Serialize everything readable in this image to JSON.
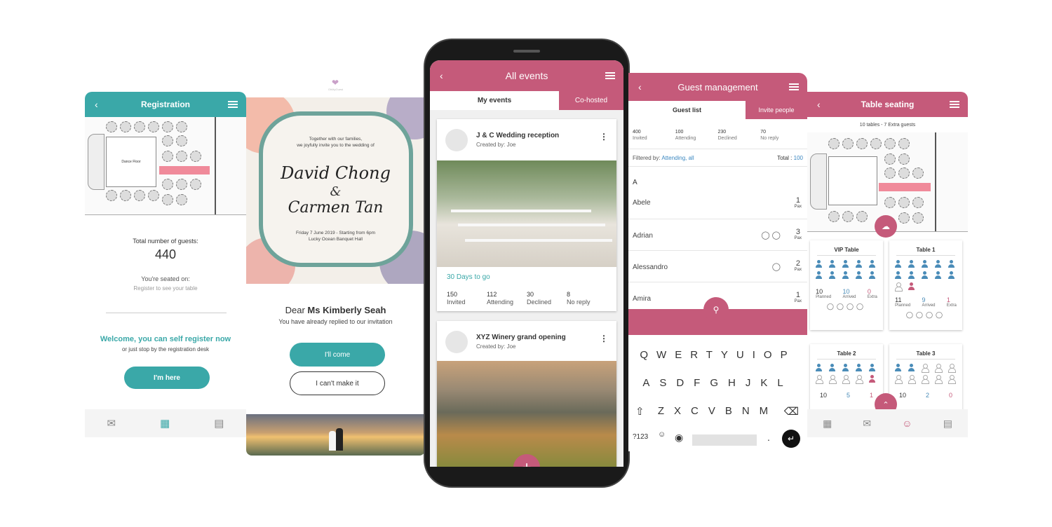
{
  "registration": {
    "title": "Registration",
    "venue_label": "Dance Floor",
    "total_label": "Total number of guests:",
    "total_value": "440",
    "seated_label": "You're seated on:",
    "seated_hint": "Register to see your table",
    "welcome": "Welcome, you can self register now",
    "welcome_sub": "or just stop by the registration desk",
    "button": "I'm here"
  },
  "invite": {
    "brand": "OhMyGuest",
    "line1": "Together with our families,",
    "line2": "we joyfully invite you to the wedding of",
    "name1": "David Chong",
    "amp": "&",
    "name2": "Carmen Tan",
    "date": "Friday 7 June 2019 - Starting from 6pm",
    "venue": "Lucky Ocean Banquet Hall",
    "dear": "Dear",
    "guest": "Ms Kimberly Seah",
    "replied": "You have already replied to our invitation",
    "come": "I'll come",
    "cant": "I can't make it"
  },
  "events": {
    "title": "All events",
    "tab1": "My events",
    "tab2": "Co-hosted",
    "e1": {
      "name": "J & C Wedding reception",
      "by": "Created by: Joe",
      "days": "30 Days to go",
      "s": [
        {
          "v": "150",
          "l": "Invited"
        },
        {
          "v": "112",
          "l": "Attending"
        },
        {
          "v": "30",
          "l": "Declined"
        },
        {
          "v": "8",
          "l": "No reply"
        }
      ]
    },
    "e2": {
      "name": "XYZ Winery grand opening",
      "by": "Created by: Joe"
    },
    "fab": "+"
  },
  "guests": {
    "title": "Guest management",
    "tab1": "Guest list",
    "tab2": "Invite people",
    "stats": [
      {
        "v": "400",
        "l": "Invited"
      },
      {
        "v": "100",
        "l": "Attending"
      },
      {
        "v": "230",
        "l": "Declined"
      },
      {
        "v": "70",
        "l": "No reply"
      }
    ],
    "filter_label": "Filtered by:",
    "filter_value": "Attending, all",
    "total_label": "Total :",
    "total_value": "100",
    "letter": "A",
    "rows": [
      {
        "name": "Abele",
        "pax": "1"
      },
      {
        "name": "Adrian",
        "pax": "3"
      },
      {
        "name": "Alessandro",
        "pax": "2"
      },
      {
        "name": "Amira",
        "pax": "1"
      }
    ],
    "pax": "Pax",
    "kb1": "QWERTYUIOP",
    "kb2": "ASDFGHJKL",
    "kb3": "ZXCVBNM",
    "kb_num": "?123",
    "kb_dot": "."
  },
  "seating": {
    "title": "Table seating",
    "summary": "10 tables - 7 Extra guests",
    "tables": [
      {
        "name": "VIP Table",
        "planned": "10",
        "arrived": "10",
        "extra": "0"
      },
      {
        "name": "Table 1",
        "planned": "11",
        "arrived": "9",
        "extra": "1"
      },
      {
        "name": "Table 2",
        "planned": "10",
        "arrived": "5",
        "extra": "1"
      },
      {
        "name": "Table 3",
        "planned": "10",
        "arrived": "2",
        "extra": "0"
      }
    ],
    "planned": "Planned",
    "arrived": "Arrived",
    "extra": "Extra"
  },
  "colors": {
    "teal": "#3aa8a8",
    "rose": "#c55a7a",
    "pink_stage": "#f08a9a"
  }
}
